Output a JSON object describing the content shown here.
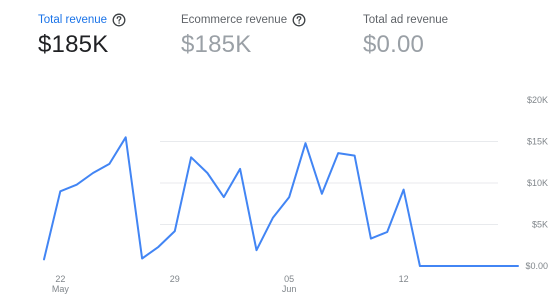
{
  "metrics": [
    {
      "label": "Total revenue",
      "value": "$185K",
      "active": true,
      "help_icon": "help-circle-icon"
    },
    {
      "label": "Ecommerce revenue",
      "value": "$185K",
      "active": false,
      "help_icon": "help-circle-icon"
    },
    {
      "label": "Total ad revenue",
      "value": "$0.00",
      "active": false
    }
  ],
  "colors": {
    "accent": "#1a73e8",
    "line": "#4285f4",
    "grid": "#e8eaed"
  },
  "chart_data": {
    "type": "line",
    "title": "",
    "xlabel": "",
    "ylabel": "",
    "x": [
      "May 21",
      "May 22",
      "May 23",
      "May 24",
      "May 25",
      "May 26",
      "May 27",
      "May 28",
      "May 29",
      "May 30",
      "May 31",
      "Jun 1",
      "Jun 2",
      "Jun 3",
      "Jun 4",
      "Jun 5",
      "Jun 6",
      "Jun 7",
      "Jun 8",
      "Jun 9",
      "Jun 10",
      "Jun 11",
      "Jun 12",
      "Jun 13",
      "Jun 14",
      "Jun 15",
      "Jun 16",
      "Jun 17",
      "Jun 18",
      "Jun 19"
    ],
    "series": [
      {
        "values": [
          800,
          9000,
          9800,
          11200,
          12300,
          15500,
          900,
          2300,
          4200,
          13100,
          11200,
          8300,
          11700,
          1900,
          5800,
          8300,
          14800,
          8700,
          13600,
          13300,
          3300,
          4100,
          9200,
          0,
          0,
          0,
          0,
          0,
          0,
          0
        ]
      }
    ],
    "y_ticks": [
      "$0.00",
      "$5K",
      "$10K",
      "$15K",
      "$20K"
    ],
    "y_tick_values": [
      0,
      5000,
      10000,
      15000,
      20000
    ],
    "x_ticks": [
      {
        "label": "22",
        "sublabel": "May",
        "index": 1
      },
      {
        "label": "29",
        "sublabel": "",
        "index": 8
      },
      {
        "label": "05",
        "sublabel": "Jun",
        "index": 15
      },
      {
        "label": "12",
        "sublabel": "",
        "index": 22
      }
    ],
    "ylim": [
      0,
      20000
    ],
    "grid": true,
    "legend": "none"
  }
}
